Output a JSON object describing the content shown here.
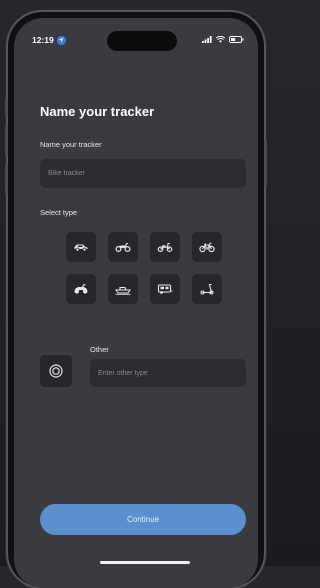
{
  "status_bar": {
    "time": "12:19",
    "location_icon": "location-arrow-icon",
    "signal_icon": "signal-icon",
    "wifi_icon": "wifi-icon",
    "battery_icon": "battery-icon"
  },
  "page": {
    "title": "Name your tracker"
  },
  "name_field": {
    "label": "Name your tracker",
    "placeholder": "Bike tracker"
  },
  "type_section": {
    "label": "Select type",
    "types": [
      {
        "icon": "car-icon"
      },
      {
        "icon": "motorcycle-icon"
      },
      {
        "icon": "scooter-moped-icon"
      },
      {
        "icon": "bicycle-icon"
      },
      {
        "icon": "atv-icon"
      },
      {
        "icon": "boat-icon"
      },
      {
        "icon": "camper-van-icon"
      },
      {
        "icon": "kick-scooter-icon"
      }
    ]
  },
  "other_field": {
    "label": "Other",
    "placeholder": "Enter other type",
    "icon": "target-icon"
  },
  "continue_button": {
    "label": "Continue"
  },
  "colors": {
    "background": "#3a3b3f",
    "field": "#2b2c30",
    "tile": "#26272b",
    "accent": "#5b8fce",
    "location": "#2f86f6"
  }
}
